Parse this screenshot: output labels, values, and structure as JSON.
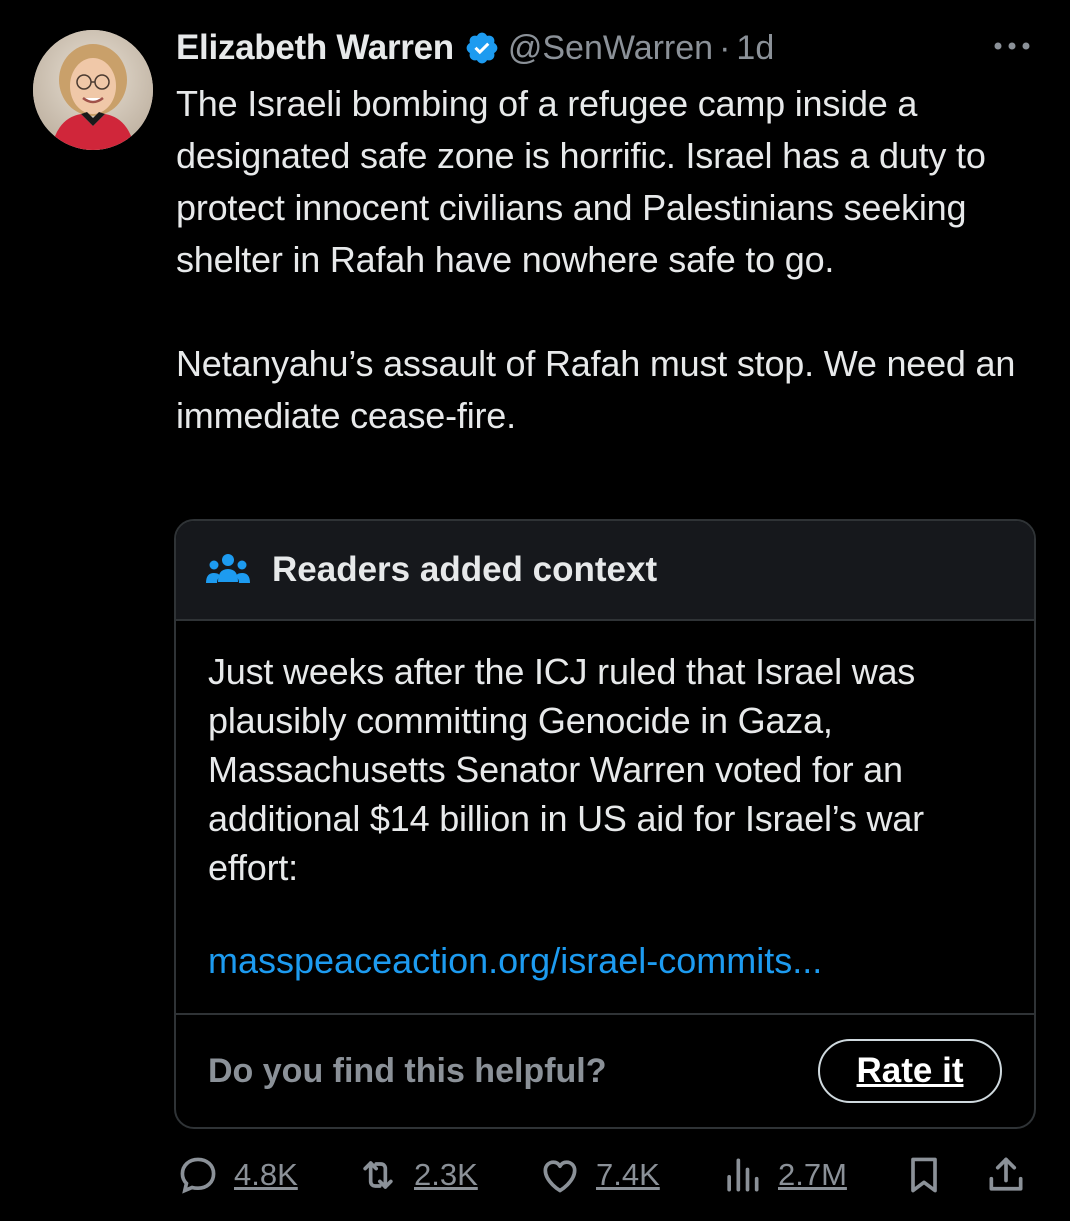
{
  "author": {
    "display_name": "Elizabeth Warren",
    "handle": "@SenWarren",
    "separator": "·",
    "time": "1d",
    "verified": true,
    "verified_color": "#1d9bf0"
  },
  "tweet": {
    "paragraphs": [
      "The Israeli bombing of a refugee camp inside a designated safe zone is horrific. Israel has a duty to protect innocent civilians and Palestinians seeking shelter in Rafah have nowhere safe to go.",
      "Netanyahu’s assault of Rafah must stop. We need an immediate cease-fire."
    ]
  },
  "community_note": {
    "title": "Readers added context",
    "text": "Just weeks after the ICJ ruled that Israel was plausibly committing Genocide in Gaza, Massachusetts Senator Warren voted for an additional $14 billion in US aid for Israel’s war effort:",
    "link_text": "masspeaceaction.org/israel-commits...",
    "helpful_question": "Do you find this helpful?",
    "rate_button_label": "Rate it",
    "accent_color": "#1d9bf0"
  },
  "actions": {
    "replies": "4.8K",
    "reposts": "2.3K",
    "likes": "7.4K",
    "views": "2.7M",
    "icons": [
      "reply-icon",
      "repost-icon",
      "like-icon",
      "views-icon",
      "bookmark-icon",
      "share-icon"
    ]
  },
  "theme": {
    "background": "#000000",
    "text_primary": "#e7e9ea",
    "text_secondary": "#8b9198",
    "link": "#1d9bf0",
    "border": "#2f3336"
  }
}
